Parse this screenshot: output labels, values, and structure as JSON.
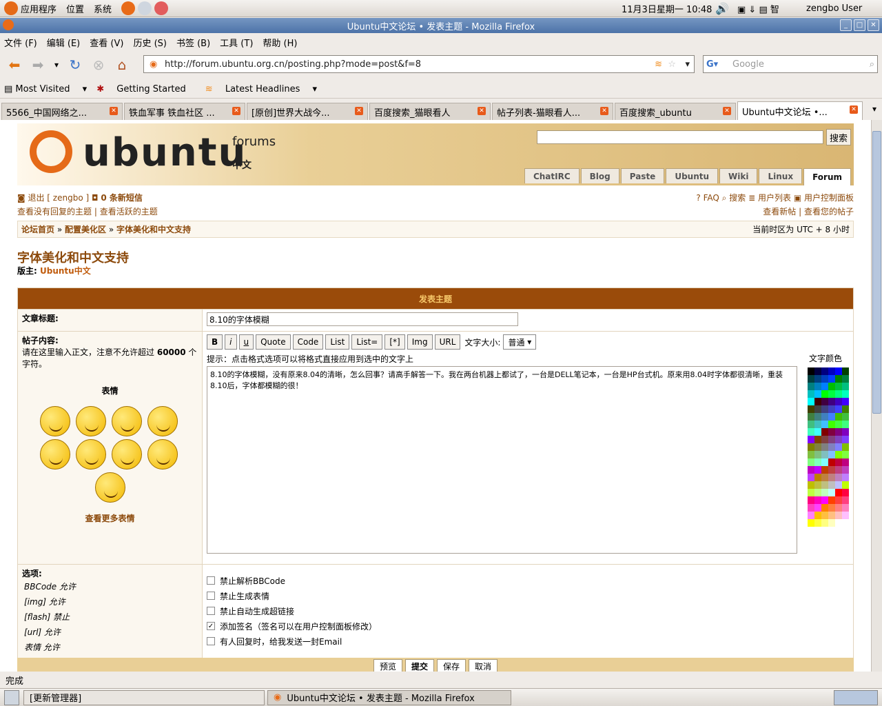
{
  "gnome": {
    "menus": [
      "应用程序",
      "位置",
      "系统"
    ],
    "datetime": "11月3日星期一 10:48",
    "user": "zengbo User"
  },
  "window": {
    "title": "Ubuntu中文论坛 • 发表主题 - Mozilla Firefox"
  },
  "menubar": [
    "文件 (F)",
    "编辑 (E)",
    "查看 (V)",
    "历史 (S)",
    "书签 (B)",
    "工具 (T)",
    "帮助 (H)"
  ],
  "nav": {
    "url": "http://forum.ubuntu.org.cn/posting.php?mode=post&f=8",
    "search_placeholder": "Google"
  },
  "bookmarks": [
    "Most Visited",
    "Getting Started",
    "Latest Headlines"
  ],
  "tabs": [
    "5566_中国网络之...",
    "铁血军事 铁血社区 ...",
    "[原创]世界大战今...",
    "百度搜索_猫眼看人",
    "帖子列表-猫眼看人...",
    "百度搜索_ubuntu",
    "Ubuntu中文论坛 •..."
  ],
  "header": {
    "logo_word": "ubuntu",
    "logo_forums": "forums",
    "logo_zh": "中文",
    "search_btn": "搜索",
    "navtabs": [
      "ChatIRC",
      "Blog",
      "Paste",
      "Ubuntu",
      "Wiki",
      "Linux",
      "Forum"
    ]
  },
  "userlinks": {
    "logout": "退出 [ zengbo ]",
    "pm": "0 条新短信",
    "faq": "FAQ",
    "search": "搜索",
    "members": "用户列表",
    "ucp": "用户控制面板",
    "unanswered": "查看没有回复的主题",
    "active": "查看活跃的主题",
    "new_posts": "查看新帖",
    "your_posts": "查看您的帖子"
  },
  "breadcrumb": {
    "home": "论坛首页",
    "sep": "»",
    "cat": "配置美化区",
    "forum": "字体美化和中文支持",
    "tz": "当前时区为 UTC + 8 小时"
  },
  "forum": {
    "title": "字体美化和中文支持",
    "mod_label": "版主:",
    "mod_name": "Ubuntu中文"
  },
  "post": {
    "header": "发表主题",
    "subject_label": "文章标题:",
    "subject_value": "8.10的字体模糊",
    "body_label": "帖子内容:",
    "body_hint_a": "请在这里输入正文，注意不允许超过",
    "body_hint_b": "60000",
    "body_hint_c": "个字符。",
    "smilies_label": "表情",
    "more_smilies": "查看更多表情",
    "bbcode": [
      "B",
      "i",
      "u",
      "Quote",
      "Code",
      "List",
      "List=",
      "[*]",
      "Img",
      "URL"
    ],
    "fontsize_label": "文字大小:",
    "fontsize_value": "普通",
    "tip": "提示：点击格式选项可以将格式直接应用到选中的文字上",
    "color_label": "文字颜色",
    "body_text": "8.10的字体模糊，没有原来8.04的清晰，怎么回事？请高手解答一下。我在两台机器上都试了，一台是DELL笔记本，一台是HP台式机。原来用8.04时字体都很清晰，重装8.10后，字体都模糊的很！",
    "options_label": "选项:",
    "option_status": [
      "BBCode 允许",
      "[img] 允许",
      "[flash] 禁止",
      "[url] 允许",
      "表情 允许"
    ],
    "checkboxes": [
      "禁止解析BBCode",
      "禁止生成表情",
      "禁止自动生成超链接",
      "添加签名（签名可以在用户控制面板修改）",
      "有人回复时，给我发送一封Email"
    ],
    "buttons": [
      "预览",
      "提交",
      "保存",
      "取消"
    ]
  },
  "status": "完成",
  "taskbar": [
    "[更新管理器]",
    "Ubuntu中文论坛 • 发表主题 - Mozilla Firefox"
  ]
}
